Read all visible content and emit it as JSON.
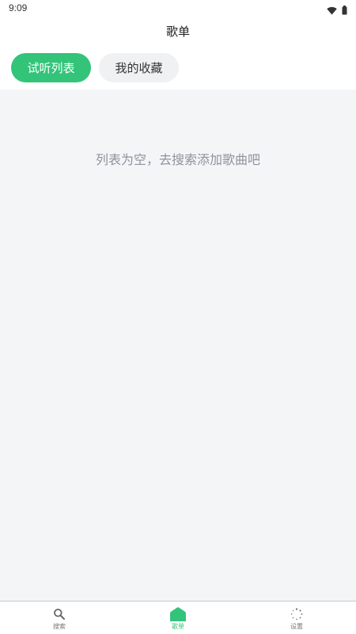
{
  "status_bar": {
    "time": "9:09",
    "icons": [
      "wifi-icon",
      "battery-icon"
    ]
  },
  "header": {
    "title": "歌单"
  },
  "tabs": [
    {
      "label": "试听列表",
      "active": true
    },
    {
      "label": "我的收藏",
      "active": false
    }
  ],
  "main": {
    "empty_message": "列表为空，去搜索添加歌曲吧"
  },
  "bottom_nav": {
    "items": [
      {
        "label": "搜索",
        "icon": "search-icon",
        "active": false
      },
      {
        "label": "歌单",
        "icon": "home-icon",
        "active": true
      },
      {
        "label": "设置",
        "icon": "loading-spinner-icon",
        "active": false
      }
    ]
  },
  "colors": {
    "accent": "#33c47a",
    "content_background": "#f4f5f7",
    "inactive_tab": "#f0f1f3",
    "empty_text": "#8e939b"
  }
}
